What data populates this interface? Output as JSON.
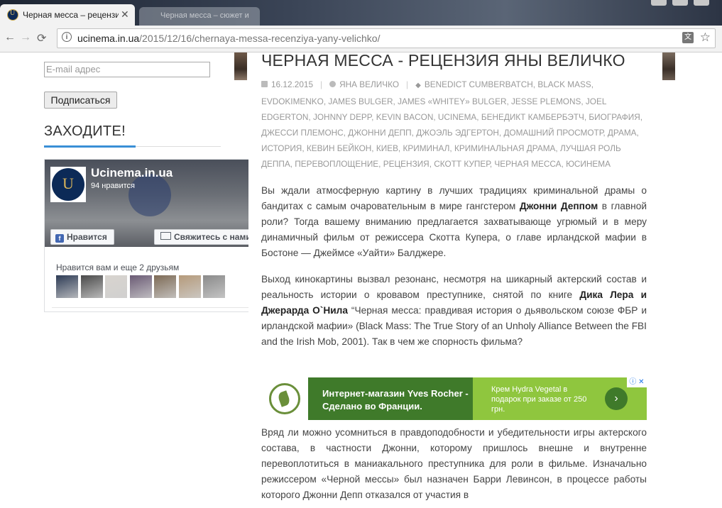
{
  "browser": {
    "tab_title": "Черная месса – рецензи",
    "tab2_title": "Черная месса – сюжет и",
    "close_glyph": "✕",
    "url_host": "ucinema.in.ua",
    "url_path": "/2015/12/16/chernaya-messa-recenziya-yany-velichko/",
    "back_glyph": "←",
    "forward_glyph": "→",
    "reload_glyph": "⟳",
    "info_glyph": "i",
    "translate_glyph": "文",
    "star_glyph": "☆"
  },
  "sidebar": {
    "email_placeholder": "E-mail адрес",
    "subscribe_label": "Подписаться",
    "widget_title": "ЗАХОДИТЕ!",
    "fb": {
      "page_name": "Ucinema.in.ua",
      "likes": "94 нравится",
      "like_button": "Нравится",
      "like_icon": "f",
      "contact_button": "Свяжитесь с нами",
      "friends_text": "Нравится вам и еще 2 друзьям",
      "face_colors": [
        "#2d3b55",
        "#4a4a4a",
        "#d8d4cf",
        "#6a5a74",
        "#7d6a55",
        "#b59a7a",
        "#8a8a8a"
      ]
    }
  },
  "post": {
    "title": "ЧЕРНАЯ МЕССА - РЕЦЕНЗИЯ ЯНЫ ВЕЛИЧКО",
    "date": "16.12.2015",
    "author": "ЯНА ВЕЛИЧКО",
    "tags": "BENEDICT CUMBERBATCH, BLACK MASS, EVDOKIMENKO, JAMES BULGER, JAMES «WHITEY» BULGER, JESSE PLEMONS, JOEL EDGERTON, JOHNNY DEPP, KEVIN BACON, UCINEMA, БЕНЕДИКТ КАМБЕРБЭТЧ, БИОГРАФИЯ, ДЖЕССИ ПЛЕМОНС, ДЖОННИ ДЕПП, ДЖОЭЛЬ ЭДГЕРТОН, ДОМАШНИЙ ПРОСМОТР, ДРАМА, ИСТОРИЯ, КЕВИН БЕЙКОН, КИЕВ, КРИМИНАЛ, КРИМИНАЛЬНАЯ ДРАМА, ЛУЧШАЯ РОЛЬ ДЕППА, ПЕРЕВОПЛОЩЕНИЕ, РЕЦЕНЗИЯ, СКОТТ КУПЕР, ЧЕРНАЯ МЕССА, ЮСИНЕМА",
    "p1_a": "Вы ждали атмосферную картину в лучших традициях криминальной драмы о бандитах с самым очаровательным в мире гангстером ",
    "p1_b": "Джонни Деппом",
    "p1_c": " в главной роли? Тогда вашему вниманию предлагается захватывающе угрюмый и в меру динамичный фильм от режиссера Скотта Купера, о главе ирландской мафии в Бостоне — Джеймсе «Уайти» Балджере.",
    "p2_a": "Выход кинокартины вызвал резонанс, несмотря на шикарный актерский состав и реальность истории о кровавом преступнике, снятой по книге ",
    "p2_b": "Дика Лера и Джерарда О`Нила",
    "p2_c": " “Черная месса: правдивая история о дьявольском союзе ФБР и ирландской мафии» (Black Mass: The True Story of an Unholy Alliance Between the FBI and the Irish Mob, 2001). Так в чем же спорность фильма?",
    "p3": "Вряд ли можно усомниться в правдоподобности и убедительности игры актерского состава, в частности Джонни, которому пришлось внешне и внутренне перевоплотиться в маниакального преступника для роли в фильме. Изначально режиссером «Черной мессы» был назначен Барри Левинсон, в процессе работы которого Джонни Депп отказался от участия в"
  },
  "ad": {
    "headline": "Интернет-магазин Yves Rocher - Сделано во Франции.",
    "offer": "Крем Hydra Vegetal в подарок при заказе от 250 грн.",
    "arrow": "›",
    "choices": "ⓘ ✕"
  }
}
